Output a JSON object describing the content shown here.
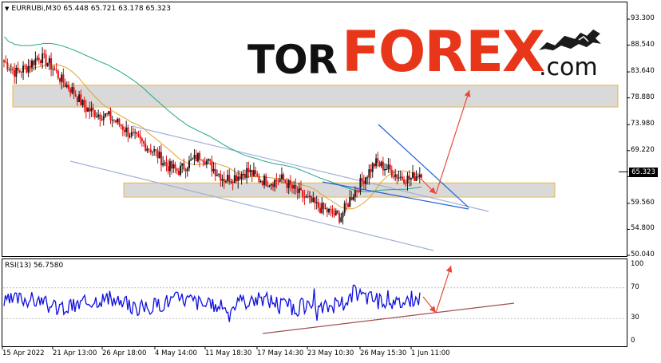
{
  "chart_header": {
    "symbol": "EURRUBi,M30",
    "ohlc": "65.448 65.721 63.178 65.323"
  },
  "current_price": "65.323",
  "logo": {
    "part1": "TOR",
    "part2": "FOREX",
    "part3": ".com"
  },
  "price_axis": [
    "93.300",
    "88.540",
    "83.640",
    "78.880",
    "73.980",
    "69.220",
    "64.460",
    "59.560",
    "54.800",
    "50.040"
  ],
  "rsi": {
    "label": "RSI(13) 56.7580",
    "axis": [
      "100",
      "70",
      "30",
      "0"
    ]
  },
  "time_axis": [
    "15 Apr 2022",
    "21 Apr 13:00",
    "26 Apr 18:00",
    "4 May 14:00",
    "11 May 18:30",
    "17 May 14:30",
    "23 May 10:30",
    "26 May 15:30",
    "1 Jun 11:00"
  ],
  "colors": {
    "bull": "#1a1a1a",
    "bear": "#e01010",
    "ma_fast": "#e3a22a",
    "ma_slow": "#20a88a",
    "zone_fill": "#d9d9d9",
    "zone_border": "#e8b84a",
    "rsi_line": "#1010e0",
    "trend": "#2060d0",
    "arrow": "#e84a3a",
    "channel": "#a0b0d8"
  },
  "chart_data": {
    "type": "candlestick",
    "symbol": "EURRUBi",
    "timeframe": "M30",
    "y_ticks": [
      93.3,
      88.54,
      83.64,
      78.88,
      73.98,
      69.22,
      64.46,
      59.56,
      54.8,
      50.04
    ],
    "ylim": [
      50.04,
      93.3
    ],
    "x_tick_labels": [
      "15 Apr 2022",
      "21 Apr 13:00",
      "26 Apr 18:00",
      "4 May 14:00",
      "11 May 18:30",
      "17 May 14:30",
      "23 May 10:30",
      "26 May 15:30",
      "1 Jun 11:00"
    ],
    "close_path": [
      85.5,
      83.5,
      84.5,
      86.5,
      85.0,
      82.0,
      80.0,
      77.0,
      76.0,
      75.5,
      74.0,
      72.0,
      70.5,
      69.0,
      66.5,
      65.5,
      67.0,
      68.5,
      66.0,
      64.0,
      64.5,
      65.5,
      64.0,
      63.5,
      64.0,
      62.0,
      60.5,
      59.0,
      58.0,
      57.0,
      61.0,
      64.0,
      67.0,
      66.0,
      64.5,
      64.0,
      65.3
    ],
    "resistance_zone": [
      77.2,
      81.2
    ],
    "support_zone": [
      60.7,
      63.3
    ],
    "rsi_period": 13,
    "rsi_value": 56.758,
    "rsi_levels": [
      70,
      30
    ],
    "rsi_ylim": [
      0,
      100
    ]
  }
}
